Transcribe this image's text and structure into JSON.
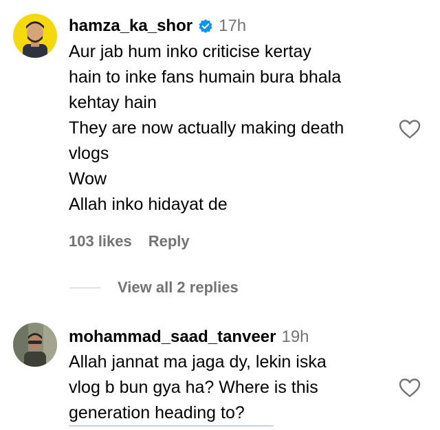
{
  "comments": [
    {
      "username": "hamza_ka_shor",
      "verified": true,
      "time": "17h",
      "lines": [
        "Aur jab hum inko criticise kertay",
        "hain to inke fans humain bura bhala",
        "kehtay hain",
        "They are now actually making death",
        "vlogs",
        "Wow",
        "Allah inko hidayat de"
      ],
      "likes": "103 likes",
      "reply_label": "Reply",
      "view_replies": "View all 2 replies"
    },
    {
      "username": "mohammad_saad_tanveer",
      "verified": false,
      "time": "19h",
      "lines": [
        "Allah jannat ma jaga dy, lekin iska",
        "vlog b bun gya ha? Where is this",
        "generation heading to?"
      ]
    }
  ],
  "icons": {
    "verified": "verified-badge-icon",
    "like": "heart-outline-icon"
  },
  "colors": {
    "verified_blue": "#0095f6",
    "secondary_text": "#737373",
    "avatar1_bg": "#f5d90f"
  }
}
